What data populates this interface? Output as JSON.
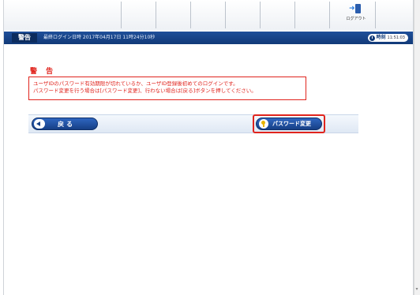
{
  "toolbar": {
    "logout_label": "ログアウト"
  },
  "statusbar": {
    "screen_title": "警告",
    "last_login": "最終ログイン日時 2017年04月17日 11時24分10秒",
    "clock_label": "時刻",
    "clock_time": "11:51:03"
  },
  "main": {
    "heading": "警 告",
    "message_lines": [
      "ユーザIDのパスワード有効期限が切れているか、ユーザID登録後初めてのログインです。",
      "パスワード変更を行う場合は[パスワード変更]、行わない場合は[戻る]ボタンを押してください。"
    ],
    "back_button": "戻る",
    "password_change_button": "パスワード変更"
  },
  "colors": {
    "warning_red": "#e0241d",
    "header_blue": "#1f4f9a",
    "button_blue": "#163f86"
  }
}
